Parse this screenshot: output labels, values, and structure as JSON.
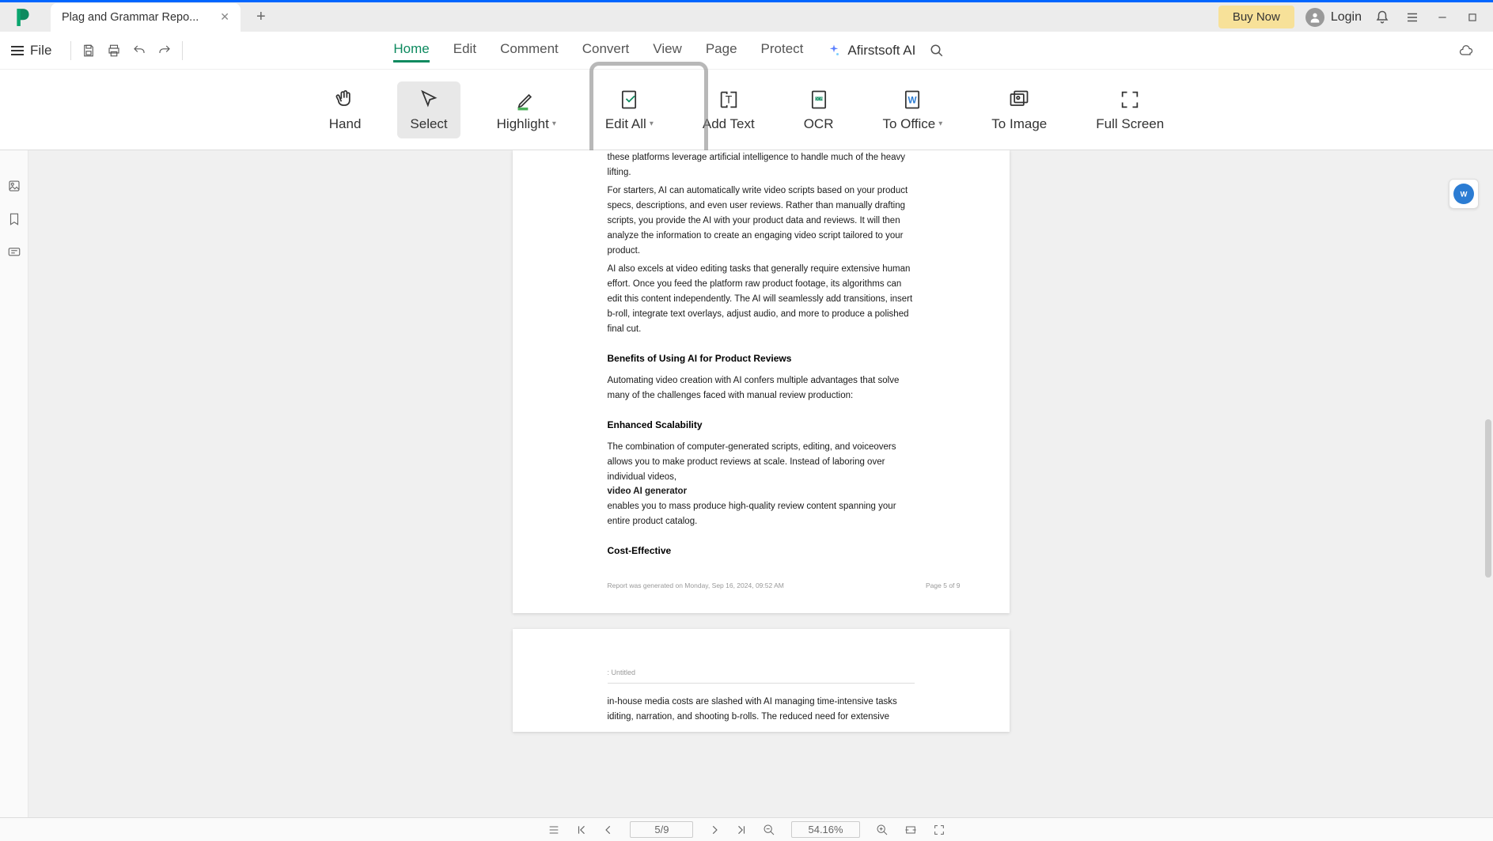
{
  "titleBar": {
    "tabTitle": "Plag and Grammar Repo...",
    "buyNow": "Buy Now",
    "login": "Login"
  },
  "menuBar": {
    "fileLabel": "File",
    "tabs": [
      "Home",
      "Edit",
      "Comment",
      "Convert",
      "View",
      "Page",
      "Protect"
    ],
    "activeTab": "Home",
    "aiLabel": "Afirstsoft AI"
  },
  "toolbar": {
    "items": [
      {
        "label": "Hand",
        "hasDropdown": false
      },
      {
        "label": "Select",
        "hasDropdown": false,
        "active": true
      },
      {
        "label": "Highlight",
        "hasDropdown": true
      },
      {
        "label": "Edit All",
        "hasDropdown": true
      },
      {
        "label": "Add Text",
        "hasDropdown": false
      },
      {
        "label": "OCR",
        "hasDropdown": false
      },
      {
        "label": "To Office",
        "hasDropdown": true
      },
      {
        "label": "To Image",
        "hasDropdown": false
      },
      {
        "label": "Full Screen",
        "hasDropdown": false
      }
    ]
  },
  "document": {
    "page1": {
      "p0": "these platforms leverage artificial intelligence to handle much of the heavy lifting.",
      "p1": "For starters, AI can automatically write video scripts based on your product specs, descriptions, and even user reviews. Rather than manually drafting scripts, you provide the AI with your product data and reviews. It will then analyze the information to create an engaging video script tailored to your product.",
      "p2": "AI also excels at video editing tasks that generally require extensive human effort. Once you feed the platform raw product footage, its algorithms can edit this content independently. The AI will seamlessly add transitions, insert b-roll, integrate text overlays, adjust audio, and more to produce a polished final cut.",
      "h1": "Benefits of Using AI for Product Reviews",
      "p3": "Automating video creation with AI confers multiple advantages that solve many of the challenges faced with manual review production:",
      "h2": "Enhanced Scalability",
      "p4a": "The combination of computer-generated scripts, editing, and voiceovers allows you to make product reviews at scale. Instead of laboring over individual videos,",
      "p4b": "video AI generator",
      "p4c": "enables you to mass produce high-quality review content spanning your entire product catalog.",
      "h3": "Cost-Effective",
      "footerLeft": "Report was generated on Monday, Sep 16, 2024, 09:52 AM",
      "footerRight": "Page 5 of 9"
    },
    "page2": {
      "subtitle": ": Untitled",
      "p1": "in-house media costs are slashed with AI managing time-intensive tasks iditing, narration, and shooting b-rolls. The reduced need for extensive"
    }
  },
  "statusBar": {
    "pageField": "5/9",
    "zoomField": "54.16%"
  }
}
